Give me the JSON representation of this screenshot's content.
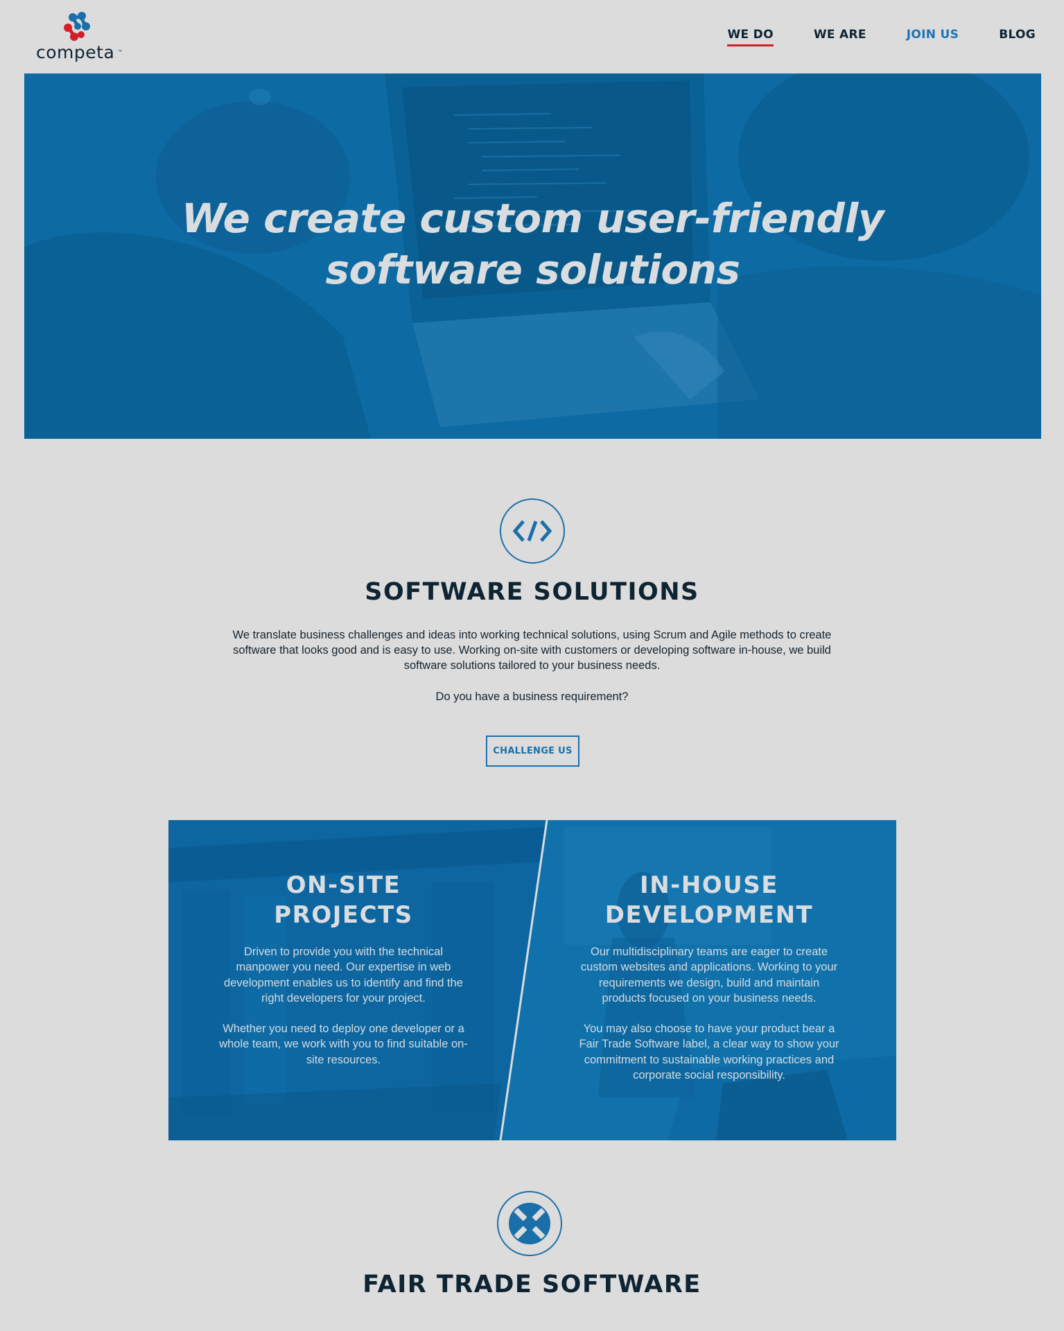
{
  "header": {
    "logo_text": "competa",
    "logo_tm": "™",
    "nav": [
      {
        "label": "WE DO"
      },
      {
        "label": "WE ARE"
      },
      {
        "label": "JOIN US"
      },
      {
        "label": "BLOG"
      }
    ]
  },
  "hero": {
    "title_line1": "We create custom user-friendly",
    "title_line2": "software solutions"
  },
  "software": {
    "icon": "code-icon",
    "title": "SOFTWARE SOLUTIONS",
    "intro": "We translate business challenges and ideas into working technical solutions, using Scrum and Agile methods to create software that looks good and is easy to use. Working on-site with customers or developing software in-house, we build software solutions tailored to your business needs.",
    "question": "Do you have a business requirement?",
    "button": "CHALLENGE US"
  },
  "panels": {
    "onsite": {
      "title_line1": "ON-SITE",
      "title_line2": "PROJECTS",
      "p1": "Driven to provide you with the technical manpower you need. Our expertise in web development enables us to identify and find the right developers for your project.",
      "p2": "Whether you need to deploy one developer or a whole team, we work with you to find suitable on-site resources."
    },
    "inhouse": {
      "title_line1": "IN-HOUSE",
      "title_line2": "DEVELOPMENT",
      "p1": "Our multidisciplinary teams are eager to create custom websites and applications. Working to your requirements we design, build and maintain products focused on your business needs.",
      "p2": "You may also choose to have your product bear a Fair Trade Software label, a clear way to show your commitment to sustainable working practices and corporate social responsibility."
    }
  },
  "fairtrade": {
    "icon": "fair-trade-icon",
    "title": "FAIR TRADE SOFTWARE"
  },
  "colors": {
    "background": "#dcdcdc",
    "brand_blue": "#1b6fa9",
    "hero_blue": "#0d6aa3",
    "nav_active_underline": "#d31e2a",
    "dark_text": "#0e2433"
  }
}
